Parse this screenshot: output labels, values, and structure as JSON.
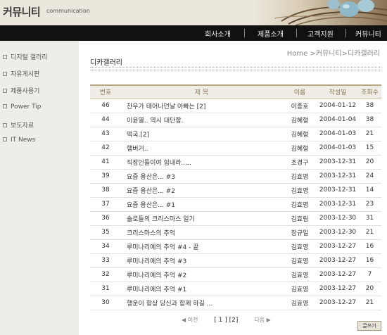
{
  "header": {
    "title": "커뮤니티",
    "subtitle": "communication"
  },
  "topnav": {
    "items": [
      "회사소개",
      "제품소개",
      "고객지원",
      "커뮤니티"
    ]
  },
  "sidebar": {
    "items": [
      "디지털 갤러리",
      "자유게시판",
      "제품사용기",
      "Power Tip",
      "보도자료",
      "IT News"
    ]
  },
  "breadcrumb": "Home >커뮤니티>디카갤러리",
  "board_title": "디카갤러리",
  "table": {
    "headers": [
      "번호",
      "제 목",
      "이름",
      "작성일",
      "조회수"
    ],
    "rows": [
      {
        "num": "46",
        "subject": "찬우가 태어나던날 아빠는 [2]",
        "name": "이종호",
        "date": "2004-01-12",
        "views": "38"
      },
      {
        "num": "44",
        "subject": "이윤열.. 역시 대단함.",
        "name": "김혜형",
        "date": "2004-01-04",
        "views": "38"
      },
      {
        "num": "43",
        "subject": "떡국.[2]",
        "name": "김혜형",
        "date": "2004-01-03",
        "views": "21"
      },
      {
        "num": "42",
        "subject": "햄버거..",
        "name": "김혜형",
        "date": "2004-01-03",
        "views": "15"
      },
      {
        "num": "41",
        "subject": "직장인들이여 힘내라.....",
        "name": "조경구",
        "date": "2003-12-31",
        "views": "20"
      },
      {
        "num": "39",
        "subject": "요즘 용산은... #3",
        "name": "김효영",
        "date": "2003-12-31",
        "views": "24"
      },
      {
        "num": "38",
        "subject": "요즘 용산은... #2",
        "name": "김효영",
        "date": "2003-12-31",
        "views": "14"
      },
      {
        "num": "37",
        "subject": "요즘 용산은... #1",
        "name": "김효영",
        "date": "2003-12-31",
        "views": "23"
      },
      {
        "num": "36",
        "subject": "솔로들의 크리스마스 일기",
        "name": "김효림",
        "date": "2003-12-30",
        "views": "31"
      },
      {
        "num": "35",
        "subject": "크리스마스의 추억",
        "name": "장규일",
        "date": "2003-12-30",
        "views": "21"
      },
      {
        "num": "34",
        "subject": "루미나리에의 추억 #4 - 끝",
        "name": "김효영",
        "date": "2003-12-27",
        "views": "16"
      },
      {
        "num": "33",
        "subject": "루미나리에의 추억 #3",
        "name": "김효영",
        "date": "2003-12-27",
        "views": "16"
      },
      {
        "num": "32",
        "subject": "루미나리에의 추억 #2",
        "name": "김효영",
        "date": "2003-12-27",
        "views": "7"
      },
      {
        "num": "31",
        "subject": "루미나리에의 추억 #1",
        "name": "김효영",
        "date": "2003-12-27",
        "views": "20"
      },
      {
        "num": "30",
        "subject": "행운이 항상 당신과 함께 하길 ...",
        "name": "김효영",
        "date": "2003-12-27",
        "views": "21"
      }
    ]
  },
  "pager": {
    "prev": "◀ 이전",
    "page1": "[ 1 ]",
    "page2": "[2]",
    "next": "다음 ▶"
  },
  "write_button": "글쓰기",
  "colors": {
    "nav_bg": "#111111",
    "sidebar_bg": "#efede8",
    "header_bg": "#ebe7dc",
    "table_header_text": "#8a7a55"
  }
}
